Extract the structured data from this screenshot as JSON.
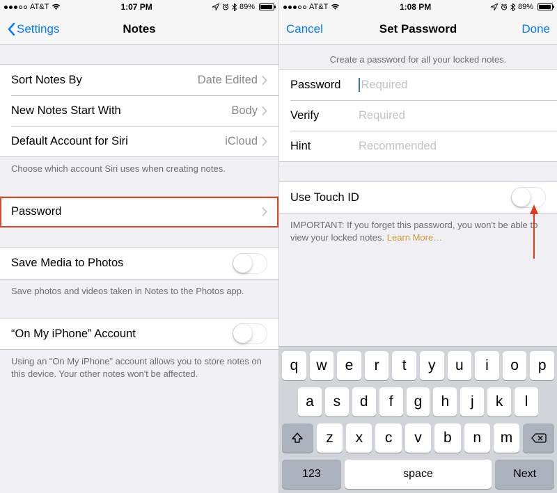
{
  "left": {
    "statusbar": {
      "carrier": "AT&T",
      "time": "1:07 PM",
      "battery": "89%"
    },
    "nav": {
      "back": "Settings",
      "title": "Notes"
    },
    "rows": {
      "sort": {
        "label": "Sort Notes By",
        "value": "Date Edited"
      },
      "start": {
        "label": "New Notes Start With",
        "value": "Body"
      },
      "siri": {
        "label": "Default Account for Siri",
        "value": "iCloud"
      },
      "pwd": {
        "label": "Password"
      },
      "media": {
        "label": "Save Media to Photos"
      },
      "onmy": {
        "label": "“On My iPhone” Account"
      }
    },
    "footers": {
      "siri": "Choose which account Siri uses when creating notes.",
      "media": "Save photos and videos taken in Notes to the Photos app.",
      "onmy": "Using an “On My iPhone” account allows you to store notes on this device. Your other notes won't be affected."
    }
  },
  "right": {
    "statusbar": {
      "carrier": "AT&T",
      "time": "1:08 PM",
      "battery": "89%"
    },
    "nav": {
      "cancel": "Cancel",
      "title": "Set Password",
      "done": "Done"
    },
    "header": "Create a password for all your locked notes.",
    "fields": {
      "password": {
        "label": "Password",
        "placeholder": "Required"
      },
      "verify": {
        "label": "Verify",
        "placeholder": "Required"
      },
      "hint": {
        "label": "Hint",
        "placeholder": "Recommended"
      }
    },
    "touchid": {
      "label": "Use Touch ID"
    },
    "important": "IMPORTANT: If you forget this password, you won't be able to view your locked notes. ",
    "learn_more": "Learn More…",
    "keyboard": {
      "row1": [
        "q",
        "w",
        "e",
        "r",
        "t",
        "y",
        "u",
        "i",
        "o",
        "p"
      ],
      "row2": [
        "a",
        "s",
        "d",
        "f",
        "g",
        "h",
        "j",
        "k",
        "l"
      ],
      "row3": [
        "z",
        "x",
        "c",
        "v",
        "b",
        "n",
        "m"
      ],
      "num": "123",
      "space": "space",
      "next": "Next"
    }
  }
}
